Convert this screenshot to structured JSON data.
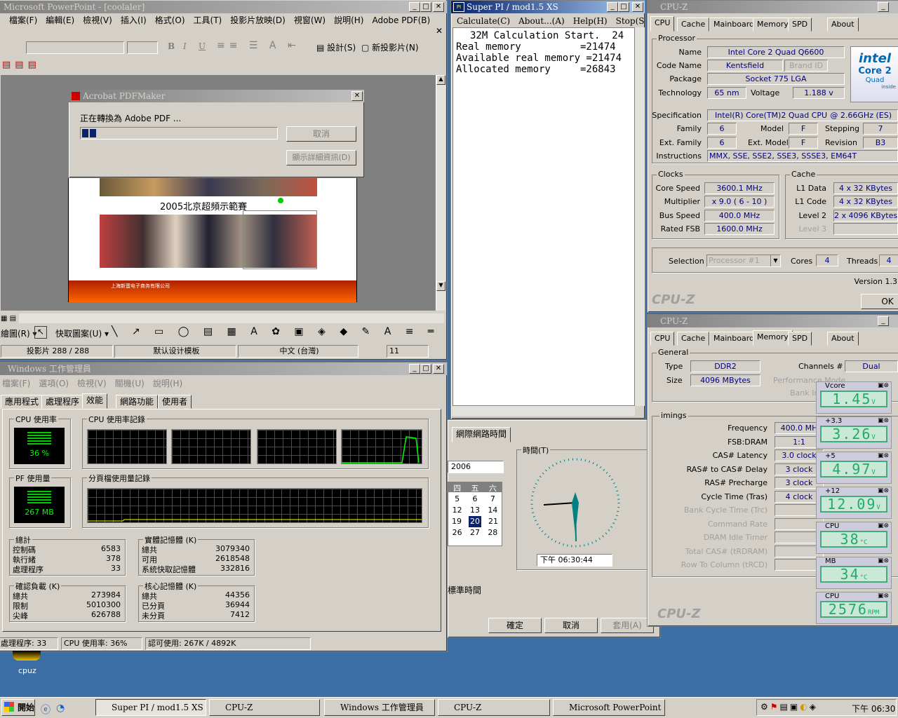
{
  "powerpoint": {
    "title": "Microsoft PowerPoint - [coolaler]",
    "menu": [
      "檔案(F)",
      "編輯(E)",
      "檢視(V)",
      "插入(I)",
      "格式(O)",
      "工具(T)",
      "投影片放映(D)",
      "視窗(W)",
      "說明(H)",
      "Adobe PDF(B)"
    ],
    "design_label": "設計(S)",
    "new_slide_label": "新投影片(N)",
    "draw_label": "繪圖(R)",
    "autoshape_label": "快取圖案(U)",
    "status": {
      "slide": "投影片 288 / 288",
      "template": "默认设计模板",
      "lang": "中文 (台灣)",
      "zoom": "11"
    },
    "slide_title": "2005北京超頻示範賽",
    "footer_text": "上海新蛋电子商务有限公司"
  },
  "pdfmaker": {
    "title": "Acrobat PDFMaker",
    "message": "正在轉換為 Adobe PDF ...",
    "cancel": "取消",
    "details": "顯示詳細資訊(D)",
    "progress": 0.08
  },
  "superpi": {
    "title": "Super PI / mod1.5 XS",
    "menu": [
      "Calculate(C)",
      "About...(A)",
      "Help(H)",
      "Stop(S)"
    ],
    "lines": [
      "32M Calculation Start.  24",
      "Real memory          =21474",
      "Available real memory =21474",
      "Allocated memory     =26843"
    ]
  },
  "datetime": {
    "tab": "網際網路時間",
    "clock_label": "時間(T)",
    "year": "2006",
    "weekdays": [
      "四",
      "五",
      "六"
    ],
    "days": [
      [
        "5",
        "6",
        "7"
      ],
      [
        "12",
        "13",
        "14"
      ],
      [
        "19",
        "20",
        "21"
      ],
      [
        "26",
        "27",
        "28"
      ]
    ],
    "selected_day": "20",
    "time": "下午  06:30:44",
    "timezone": "標準時間",
    "ok": "確定",
    "cancel": "取消",
    "apply": "套用(A)"
  },
  "cpuz1": {
    "title": "CPU-Z",
    "tabs": [
      "CPU",
      "Cache",
      "Mainboard",
      "Memory",
      "SPD",
      "About"
    ],
    "processor": {
      "label": "Processor",
      "name": "Intel Core 2 Quad Q6600",
      "code_name": "Kentsfield",
      "brand_id": "Brand ID",
      "package": "Socket 775 LGA",
      "technology": "65 nm",
      "voltage": "1.188 v",
      "specification": "Intel(R) Core(TM)2 Quad CPU",
      "spec_freq": "@ 2.66GHz (ES)",
      "family": "6",
      "model": "F",
      "stepping": "7",
      "ext_family": "6",
      "ext_model": "F",
      "revision": "B3",
      "instructions": "MMX, SSE, SSE2, SSE3, SSSE3, EM64T"
    },
    "labels": {
      "name": "Name",
      "code_name": "Code Name",
      "package": "Package",
      "technology": "Technology",
      "voltage": "Voltage",
      "specification": "Specification",
      "family": "Family",
      "model": "Model",
      "stepping": "Stepping",
      "ext_family": "Ext. Family",
      "ext_model": "Ext. Model",
      "revision": "Revision",
      "instructions": "Instructions",
      "clocks": "Clocks",
      "core_speed": "Core Speed",
      "multiplier": "Multiplier",
      "bus_speed": "Bus Speed",
      "rated_fsb": "Rated FSB",
      "cache": "Cache",
      "l1_data": "L1 Data",
      "l1_code": "L1 Code",
      "level2": "Level 2",
      "level3": "Level 3",
      "selection": "Selection",
      "cores": "Cores",
      "threads": "Threads"
    },
    "clocks": {
      "core_speed": "3600.1 MHz",
      "multiplier": "x 9.0 ( 6 - 10 )",
      "bus_speed": "400.0 MHz",
      "rated_fsb": "1600.0 MHz"
    },
    "cache": {
      "l1_data": "4 x 32 KBytes",
      "l1_code": "4 x 32 KBytes",
      "level2": "2 x 4096 KBytes"
    },
    "selection": "Processor #1",
    "cores": "4",
    "threads": "4",
    "version": "Version 1.3",
    "ok": "OK",
    "brand": "CPU-Z",
    "logo_text": "intel",
    "logo_sub": "Core 2",
    "logo_sub2": "Quad",
    "logo_inside": "inside"
  },
  "cpuz2": {
    "title": "CPU-Z",
    "tabs": [
      "CPU",
      "Cache",
      "Mainboard",
      "Memory",
      "SPD",
      "About"
    ],
    "general": "General",
    "type_label": "Type",
    "type": "DDR2",
    "size_label": "Size",
    "size": "4096 MBytes",
    "channels_label": "Channels #",
    "channels": "Dual",
    "perf_mode": "Performance Mode",
    "bank_int": "Bank Inte",
    "timings": "imings",
    "labels": [
      "Frequency",
      "FSB:DRAM",
      "CAS# Latency",
      "RAS# to CAS# Delay",
      "RAS# Precharge",
      "Cycle Time (Tras)",
      "Bank Cycle Time (Trc)",
      "Command Rate",
      "DRAM Idle Timer",
      "Total CAS# (tRDRAM)",
      "Row To Column (tRCD)"
    ],
    "values": [
      "400.0 MH",
      "1:1",
      "3.0 clock",
      "3 clock",
      "3 clock",
      "4 clock",
      "",
      "",
      "",
      "",
      ""
    ],
    "brand": "CPU-Z"
  },
  "monitor": [
    {
      "name": "Vcore",
      "value": "1.45",
      "unit": "V"
    },
    {
      "name": "+3.3",
      "value": "3.26",
      "unit": "V"
    },
    {
      "name": "+5",
      "value": "4.97",
      "unit": "V"
    },
    {
      "name": "+12",
      "value": "12.09",
      "unit": "V"
    },
    {
      "name": "CPU",
      "value": "38",
      "unit": "°C"
    },
    {
      "name": "MB",
      "value": "34",
      "unit": "°C"
    },
    {
      "name": "CPU",
      "value": "2576",
      "unit": "RPM"
    }
  ],
  "taskmgr": {
    "title": "Windows 工作管理員",
    "menu": [
      "檔案(F)",
      "選項(O)",
      "檢視(V)",
      "關機(U)",
      "說明(H)"
    ],
    "tabs": [
      "應用程式",
      "處理程序",
      "效能",
      "網路功能",
      "使用者"
    ],
    "cpu_usage_label": "CPU 使用率",
    "cpu_usage": "36 %",
    "cpu_history_label": "CPU 使用率記錄",
    "pf_label": "PF 使用量",
    "pf_value": "267 MB",
    "pf_history_label": "分頁檔使用量記錄",
    "totals": {
      "label": "總計",
      "rows": [
        [
          "控制碼",
          "6583"
        ],
        [
          "執行緒",
          "378"
        ],
        [
          "處理程序",
          "33"
        ]
      ]
    },
    "physical": {
      "label": "實體記憶體 (K)",
      "rows": [
        [
          "總共",
          "3079340"
        ],
        [
          "可用",
          "2618548"
        ],
        [
          "系統快取記憶體",
          "332816"
        ]
      ]
    },
    "commit": {
      "label": "確認負載 (K)",
      "rows": [
        [
          "總共",
          "273984"
        ],
        [
          "限制",
          "5010300"
        ],
        [
          "尖峰",
          "626788"
        ]
      ]
    },
    "kernel": {
      "label": "核心記憶體 (K)",
      "rows": [
        [
          "總共",
          "44356"
        ],
        [
          "已分頁",
          "36944"
        ],
        [
          "未分頁",
          "7412"
        ]
      ]
    },
    "status": [
      "處理程序: 33",
      "CPU 使用率: 36%",
      "認可使用: 267K / 4892K"
    ]
  },
  "desktop": {
    "icon_label": "cpuz"
  },
  "taskbar": {
    "start": "開始",
    "items": [
      "Super PI / mod1.5 XS",
      "CPU-Z",
      "Windows 工作管理員",
      "CPU-Z",
      "Microsoft PowerPoint - [c..."
    ],
    "clock": "下午 06:30"
  }
}
